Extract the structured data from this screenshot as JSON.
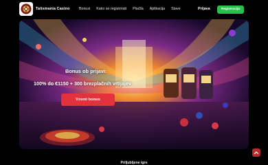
{
  "header": {
    "brand": "Talismania Casino",
    "nav": [
      {
        "label": "Bonusi"
      },
      {
        "label": "Kako se registrirati"
      },
      {
        "label": "Plaćila"
      },
      {
        "label": "Aplikacija"
      },
      {
        "label": "Stave"
      }
    ],
    "login_label": "Prijava",
    "register_label": "Registracija"
  },
  "hero": {
    "title": "Bonus ob prijavi:",
    "subtitle": "100% do €1150 + 300 brezplačnih vrtljajev",
    "cta_label": "Vzemi bonus"
  },
  "section": {
    "title": "Priljubljene igre"
  },
  "colors": {
    "register": "#27c24a",
    "cta": "#e3313d",
    "scroll_top": "#b52a2a"
  },
  "icons": {
    "logo": "talisman-logo-icon",
    "scroll_top": "chevron-up-icon"
  }
}
